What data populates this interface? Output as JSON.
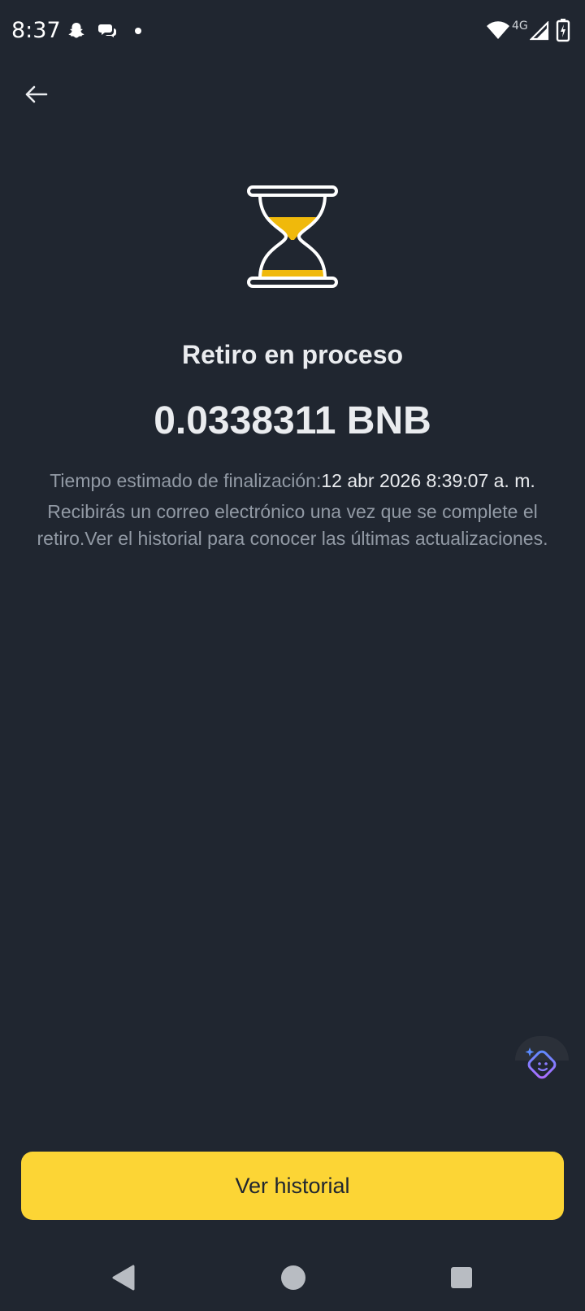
{
  "status_bar": {
    "time": "8:37",
    "network": "4G",
    "icons": [
      "snapchat-icon",
      "chat-bubbles-icon",
      "dot-icon",
      "wifi-icon",
      "signal-icon",
      "battery-charging-icon"
    ]
  },
  "header": {
    "back_icon": "arrow-left-icon"
  },
  "status": {
    "icon": "hourglass-icon",
    "title": "Retiro en proceso",
    "amount": "0.0338311 BNB",
    "eta_label": "Tiempo estimado de finalización:",
    "eta_value": "12 abr 2026 8:39:07 a. m.",
    "note": "Recibirás un correo electrónico una vez que se complete el retiro.Ver el historial para conocer las últimas actualizaciones."
  },
  "assistant": {
    "icon": "assistant-bot-icon"
  },
  "actions": {
    "primary_label": "Ver historial"
  },
  "colors": {
    "background": "#202630",
    "accent": "#fcd535",
    "text_primary": "#eaecef",
    "text_secondary": "#929aa5"
  },
  "nav_bar": {
    "icons": [
      "back-triangle-icon",
      "home-circle-icon",
      "recents-square-icon"
    ]
  }
}
